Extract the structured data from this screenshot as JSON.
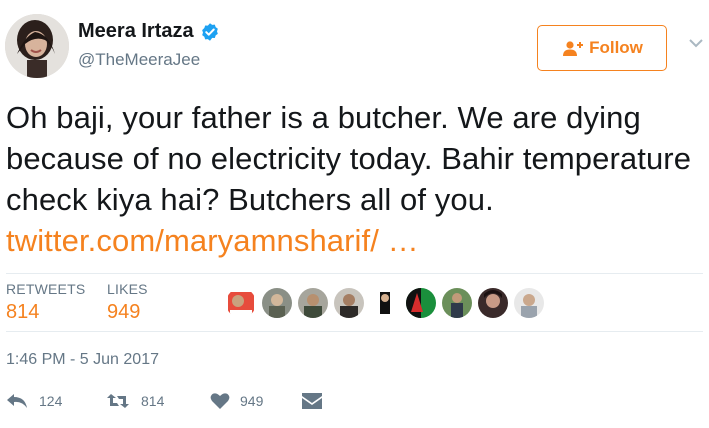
{
  "author": {
    "name": "Meera Irtaza",
    "handle": "@TheMeeraJee",
    "verified_icon": "verified-badge-icon"
  },
  "follow_button": {
    "label": "Follow",
    "icon": "add-person-icon"
  },
  "tweet": {
    "text": "Oh baji, your father is a butcher. We are dying because of no electricity today. Bahir temperature check kiya hai? Butchers all of you.",
    "link_text": "twitter.com/maryamnsharif/ …"
  },
  "stats": {
    "retweets_label": "RETWEETS",
    "retweets_value": "814",
    "likes_label": "LIKES",
    "likes_value": "949"
  },
  "timestamp": "1:46 PM - 5 Jun 2017",
  "actions": {
    "reply_count": "124",
    "retweet_count": "814",
    "like_count": "949"
  },
  "colors": {
    "accent": "#f5821f",
    "secondary_text": "#657786",
    "verified": "#1da1f2"
  }
}
